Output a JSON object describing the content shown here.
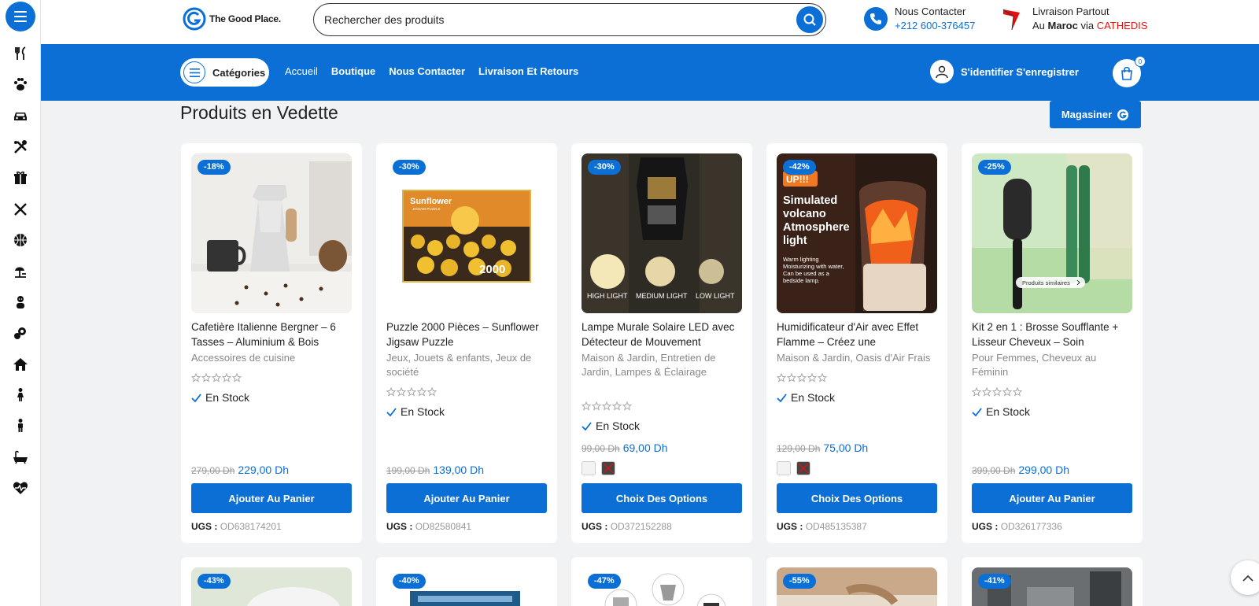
{
  "brand": {
    "name": "The Good Place."
  },
  "search": {
    "placeholder": "Rechercher des produits"
  },
  "contact": {
    "label": "Nous Contacter",
    "phone": "+212 600-376457"
  },
  "delivery": {
    "line1": "Livraison Partout",
    "line2_prefix": "Au",
    "line2_bold": "Maroc",
    "line2_mid": "via",
    "line2_carrier": "CATHEDIS"
  },
  "nav": {
    "categories_label": "Catégories",
    "links": [
      "Accueil",
      "Boutique",
      "Nous Contacter",
      "Livraison Et Retours"
    ],
    "account_label": "S'identifier S'enregistrer",
    "cart_count": "0"
  },
  "sidebar": {
    "icons": [
      "kitchen-tools-icon",
      "paw-icon",
      "car-icon",
      "tools-icon",
      "gift-icon",
      "cutlery-icon",
      "sports-ball-icon",
      "garden-icon",
      "baby-icon",
      "beauty-icon",
      "home-icon",
      "woman-icon",
      "man-icon",
      "bathtub-icon",
      "heart-pulse-icon"
    ]
  },
  "section": {
    "title": "Produits en Vedette",
    "shop_button": "Magasiner"
  },
  "products": [
    {
      "badge": "-18%",
      "name": "Cafetière Italienne Bergner – 6 Tasses – Aluminium & Bois",
      "categories": "Accessoires de cuisine",
      "stock": "En Stock",
      "old_price": "279,00 Dh",
      "price": "229,00 Dh",
      "cta": "Ajouter Au Panier",
      "sku_label": "UGS :",
      "sku": "OD638174201"
    },
    {
      "badge": "-30%",
      "name": "Puzzle 2000 Pièces – Sunflower Jigsaw Puzzle",
      "categories": "Jeux, Jouets & enfants, Jeux de société",
      "stock": "En Stock",
      "old_price": "199,00 Dh",
      "price": "139,00 Dh",
      "cta": "Ajouter Au Panier",
      "sku_label": "UGS :",
      "sku": "OD82580841"
    },
    {
      "badge": "-30%",
      "name": "Lampe Murale Solaire LED avec Détecteur de Mouvement",
      "categories": "Maison & Jardin, Entretien de Jardin, Lampes & Éclairage",
      "stock": "En Stock",
      "old_price": "99,00 Dh",
      "price": "69,00 Dh",
      "cta": "Choix Des Options",
      "sku_label": "UGS :",
      "sku": "OD372152288"
    },
    {
      "badge": "-42%",
      "name": "Humidificateur d'Air avec Effet Flamme – Créez une",
      "categories": "Maison & Jardin, Oasis d'Air Frais",
      "stock": "En Stock",
      "old_price": "129,00 Dh",
      "price": "75,00 Dh",
      "cta": "Choix Des Options",
      "sku_label": "UGS :",
      "sku": "OD485135387"
    },
    {
      "badge": "-25%",
      "name": "Kit 2 en 1 : Brosse Soufflante + Lisseur Cheveux – Soin",
      "categories": "Pour Femmes, Cheveux au Féminin",
      "stock": "En Stock",
      "old_price": "399,00 Dh",
      "price": "299,00 Dh",
      "cta": "Ajouter Au Panier",
      "sku_label": "UGS :",
      "sku": "OD326177336"
    }
  ],
  "product_images": {
    "puzzle_title": "Sunflower",
    "puzzle_sub": "JIGSAW PUZZLE",
    "puzzle_count": "2000",
    "lamp_labels": [
      "HIGH LIGHT",
      "MEDIUM LIGHT",
      "LOW LIGHT"
    ],
    "humid_sticker": "UP!!!",
    "humid_title": "Simulated volcano Atmosphere light",
    "humid_desc": "Warm lighting Moisturizing with water, Can be used as a bedside lamp.",
    "hair_pill": "Produits similaires"
  },
  "second_row_badges": [
    "-43%",
    "-40%",
    "-47%",
    "-55%",
    "-41%"
  ],
  "colors": {
    "accent": "#0b6fd6",
    "red": "#e11111"
  }
}
